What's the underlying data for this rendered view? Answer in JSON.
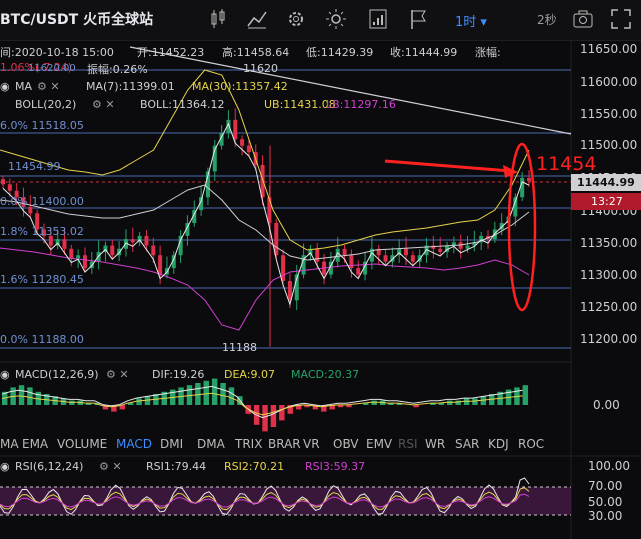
{
  "header": {
    "pair": "BTC/USDT 火币全球站",
    "timeframe": "1时",
    "refresh": "2秒"
  },
  "ohlc": {
    "time": "间:2020-10-18 15:00",
    "open": "开:11452.23",
    "high": "高:11458.64",
    "low": "低:11429.39",
    "close": "收:11444.99",
    "change": "涨幅:",
    "change_detail": "1.06%(-7.24)",
    "amplitude": "振幅:0.26%"
  },
  "ma_line": {
    "label": "MA",
    "ma7": "MA(7):11399.01",
    "ma30": "MA(30):11357.42"
  },
  "boll_line": {
    "label": "BOLL(20,2)",
    "boll": "BOLL:11364.12",
    "ub": "UB:11431.08",
    "lb": "LB:11297.16"
  },
  "fib_labels": {
    "top": "11620.00",
    "f1": "6.0% 11518.05",
    "f2": "11454.99",
    "f3": "0.0% 11400.00",
    "f4": "1.8% 11353.02",
    "f5": "1.6% 11280.45",
    "f6": "0.0% 11188.00"
  },
  "annotations": {
    "high_marker": "11620",
    "low_marker": "11188",
    "arrow_text": "11454"
  },
  "price_axis": [
    "11650.00",
    "11600.00",
    "11550.00",
    "11500.00",
    "11450.00",
    "11400.00",
    "11350.00",
    "11300.00",
    "11250.00",
    "11200.00"
  ],
  "current_price": "11444.99",
  "countdown": "13:27",
  "macd": {
    "label": "MACD(12,26,9)",
    "dif": "DIF:19.26",
    "dea": "DEA:9.07",
    "macd": "MACD:20.37",
    "axis": "0.00"
  },
  "indicator_tabs": [
    "MA",
    "EMA",
    "VOLUME",
    "MACD",
    "DMI",
    "DMA",
    "TRIX",
    "BRAR",
    "VR",
    "OBV",
    "EMV",
    "RSI",
    "WR",
    "SAR",
    "KDJ",
    "ROC"
  ],
  "active_tab": "MACD",
  "rsi": {
    "label": "RSI(6,12,24)",
    "rsi1": "RSI1:79.44",
    "rsi2": "RSI2:70.21",
    "rsi3": "RSI3:59.37",
    "axis": [
      "100.00",
      "70.00",
      "50.00",
      "30.00"
    ]
  },
  "colors": {
    "up": "#26a269",
    "down": "#e0304a",
    "accent": "#3f8cff",
    "yellow": "#e6d44a",
    "magenta": "#d040d0",
    "annot": "#ff2020"
  }
}
